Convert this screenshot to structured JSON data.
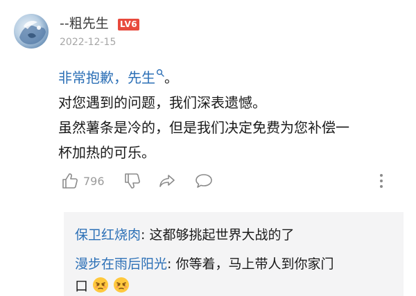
{
  "comment": {
    "username": "--粗先生",
    "level_badge": "LV6",
    "date": "2022-12-15",
    "mention": "非常抱歉，先生",
    "mention_tail": "。",
    "lines": [
      "对您遇到的问题，我们深表遗憾。",
      "虽然薯条是冷的，但是我们决定免费为您补偿一",
      "杯加热的可乐。"
    ],
    "like_count": "796"
  },
  "icons": {
    "like": "thumbs-up-icon",
    "dislike": "thumbs-down-icon",
    "share": "share-icon",
    "reply": "comment-bubble-icon",
    "more": "more-vertical-icon"
  },
  "replies": [
    {
      "author": "保卫红烧肉",
      "text": ": 这都够挑起世界大战的了"
    },
    {
      "author": "漫步在雨后阳光",
      "text": ": 你等着，马上带人到你家门"
    },
    {
      "author": "",
      "text": "口"
    }
  ],
  "colors": {
    "link": "#2b6fb6",
    "badge": "#e84a3d",
    "muted": "#9a9a9a",
    "reply_bg": "#f4f4f5"
  }
}
